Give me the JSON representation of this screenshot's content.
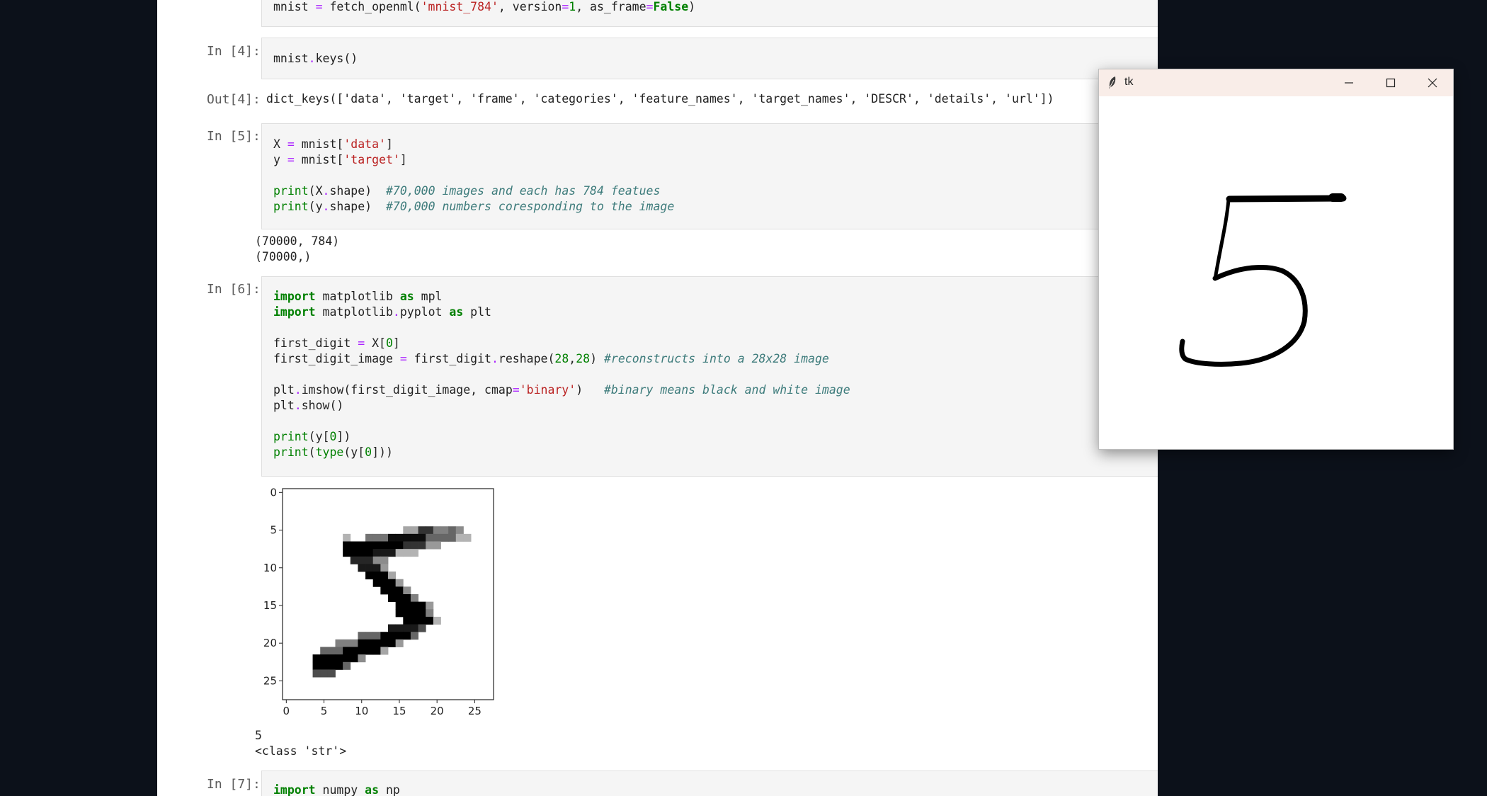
{
  "notebook": {
    "cell3": {
      "code_line": "mnist = fetch_openml('mnist_784', version=1, as_frame=False)"
    },
    "cell4": {
      "prompt": "In [4]:",
      "code": "mnist.keys()",
      "out_prompt": "Out[4]:",
      "output": "dict_keys(['data', 'target', 'frame', 'categories', 'feature_names', 'target_names', 'DESCR', 'details', 'url'])"
    },
    "cell5": {
      "prompt": "In [5]:",
      "line1": "X = mnist['data']",
      "line2": "y = mnist['target']",
      "line3": "print(X.shape)  #70,000 images and each has 784 featues",
      "line4": "print(y.shape)  #70,000 numbers coresponding to the image",
      "output_line1": "(70000, 784)",
      "output_line2": "(70000,)"
    },
    "cell6": {
      "prompt": "In [6]:",
      "line1": "import matplotlib as mpl",
      "line2": "import matplotlib.pyplot as plt",
      "line3": "first_digit = X[0]",
      "line4": "first_digit_image = first_digit.reshape(28,28) #reconstructs into a 28x28 image",
      "line5": "plt.imshow(first_digit_image, cmap='binary')   #binary means black and white image",
      "line6": "plt.show()",
      "line7": "print(y[0])",
      "line8": "print(type(y[0]))",
      "output_line1": "5",
      "output_line2": "<class 'str'>"
    },
    "cell7": {
      "prompt": "In [7]:",
      "code": "import numpy as np"
    }
  },
  "plot": {
    "x_ticks": [
      "0",
      "5",
      "10",
      "15",
      "20",
      "25"
    ],
    "y_ticks": [
      "0",
      "5",
      "10",
      "15",
      "20",
      "25"
    ]
  },
  "tk_window": {
    "title": "tk",
    "canvas_drawing": "handwritten-5"
  },
  "colors": {
    "desktop": "#0c111a",
    "keyword": "#008000",
    "operator": "#aa22ff",
    "string": "#ba2121",
    "comment": "#3d7b7b"
  }
}
